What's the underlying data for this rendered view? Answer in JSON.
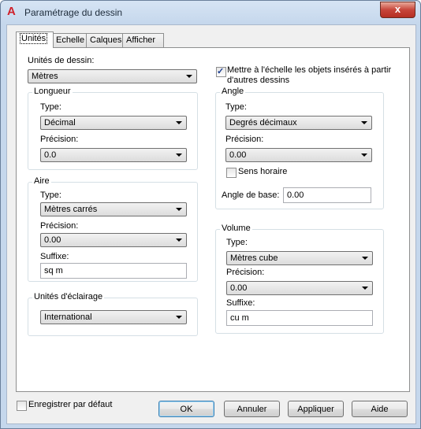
{
  "window": {
    "title": "Paramétrage du dessin",
    "close_glyph": "x",
    "app_icon_glyph": "A"
  },
  "tabs": [
    {
      "label": "Unités",
      "active": true
    },
    {
      "label": "Echelle",
      "active": false
    },
    {
      "label": "Calques",
      "active": false
    },
    {
      "label": "Afficher",
      "active": false
    }
  ],
  "drawing_units": {
    "label": "Unités de dessin:",
    "value": "Mètres"
  },
  "scale_objects": {
    "checked": true,
    "line1": "Mettre à l'échelle les objets insérés à partir",
    "line2": "d'autres dessins"
  },
  "length": {
    "legend": "Longueur",
    "type_label": "Type:",
    "type_value": "Décimal",
    "precision_label": "Précision:",
    "precision_value": "0.0"
  },
  "area": {
    "legend": "Aire",
    "type_label": "Type:",
    "type_value": "Mètres carrés",
    "precision_label": "Précision:",
    "precision_value": "0.00",
    "suffix_label": "Suffixe:",
    "suffix_value": "sq m"
  },
  "lighting": {
    "legend": "Unités d'éclairage",
    "value": "International"
  },
  "angle": {
    "legend": "Angle",
    "type_label": "Type:",
    "type_value": "Degrés décimaux",
    "precision_label": "Précision:",
    "precision_value": "0.00",
    "clockwise_label": "Sens horaire",
    "clockwise_checked": false,
    "base_label": "Angle de base:",
    "base_value": "0.00"
  },
  "volume": {
    "legend": "Volume",
    "type_label": "Type:",
    "type_value": "Mètres cube",
    "precision_label": "Précision:",
    "precision_value": "0.00",
    "suffix_label": "Suffixe:",
    "suffix_value": "cu m"
  },
  "footer": {
    "save_default_label": "Enregistrer par défaut",
    "save_default_checked": false,
    "ok": "OK",
    "cancel": "Annuler",
    "apply": "Appliquer",
    "help": "Aide"
  }
}
